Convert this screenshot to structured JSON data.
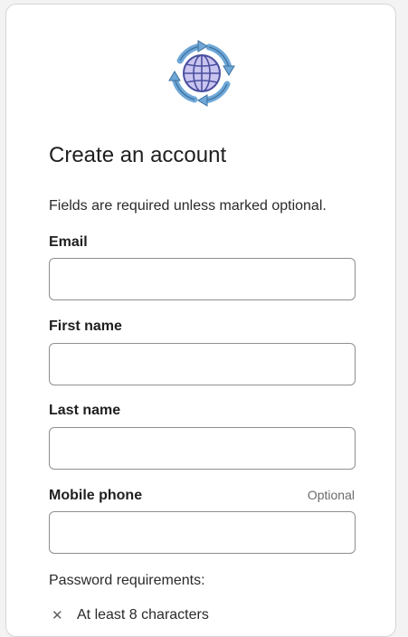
{
  "logo": {
    "icon": "globe-sync-icon",
    "colors": {
      "ring": "#6fa8d8",
      "globe_fill": "#c9c4f0",
      "globe_stroke": "#4a4f9e"
    }
  },
  "form": {
    "title": "Create an account",
    "subtitle": "Fields are required unless marked optional.",
    "fields": {
      "email": {
        "label": "Email",
        "value": "",
        "placeholder": ""
      },
      "first_name": {
        "label": "First name",
        "value": "",
        "placeholder": ""
      },
      "last_name": {
        "label": "Last name",
        "value": "",
        "placeholder": ""
      },
      "mobile_phone": {
        "label": "Mobile phone",
        "optional_label": "Optional",
        "value": "",
        "placeholder": ""
      }
    },
    "password_requirements": {
      "heading": "Password requirements:",
      "items": [
        {
          "icon": "x-icon",
          "glyph": "✕",
          "text": "At least 8 characters"
        }
      ]
    }
  }
}
